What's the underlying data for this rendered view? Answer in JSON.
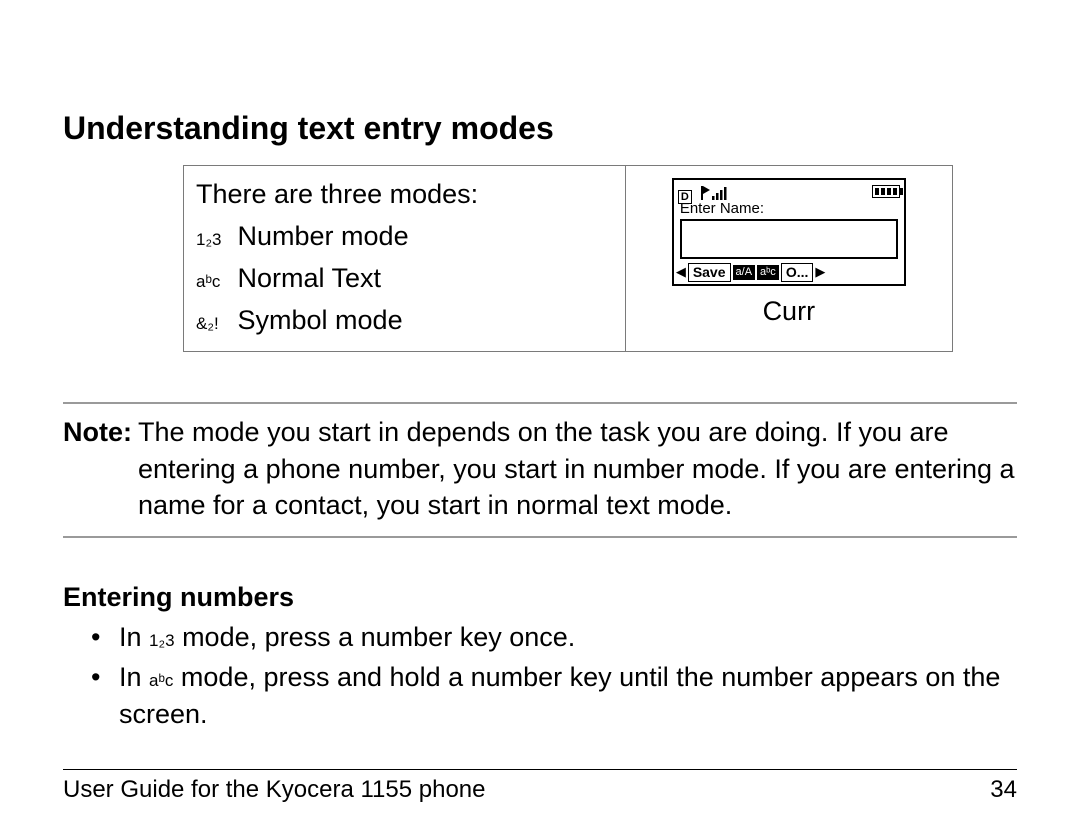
{
  "heading": "Understanding text entry modes",
  "modes": {
    "intro": "There are three modes:",
    "items": [
      {
        "icon": "1₂3",
        "label": "Number mode"
      },
      {
        "icon": "aᵇc",
        "label": "Normal Text"
      },
      {
        "icon": "&₂!",
        "label": "Symbol mode"
      }
    ]
  },
  "screen": {
    "d_indicator": "D",
    "prompt": "Enter Name:",
    "soft_left": "Save",
    "chip1": "a/A",
    "chip2": "aᵇc",
    "soft_right": "O...",
    "caption": "Curr"
  },
  "note": {
    "label": "Note:",
    "text": "The mode you start in depends on the task you are doing. If you are entering a phone number, you start in number mode. If you are entering a name for a contact, you start in normal text mode."
  },
  "section2": {
    "heading": "Entering numbers",
    "bullets": [
      {
        "pre": "In ",
        "icon": "1₂3",
        "post": " mode, press a number key once."
      },
      {
        "pre": "In ",
        "icon": "aᵇc",
        "post": " mode, press and hold a number key until the number appears on the screen."
      }
    ]
  },
  "footer": {
    "left": "User Guide for the Kyocera 1155 phone",
    "right": "34"
  }
}
